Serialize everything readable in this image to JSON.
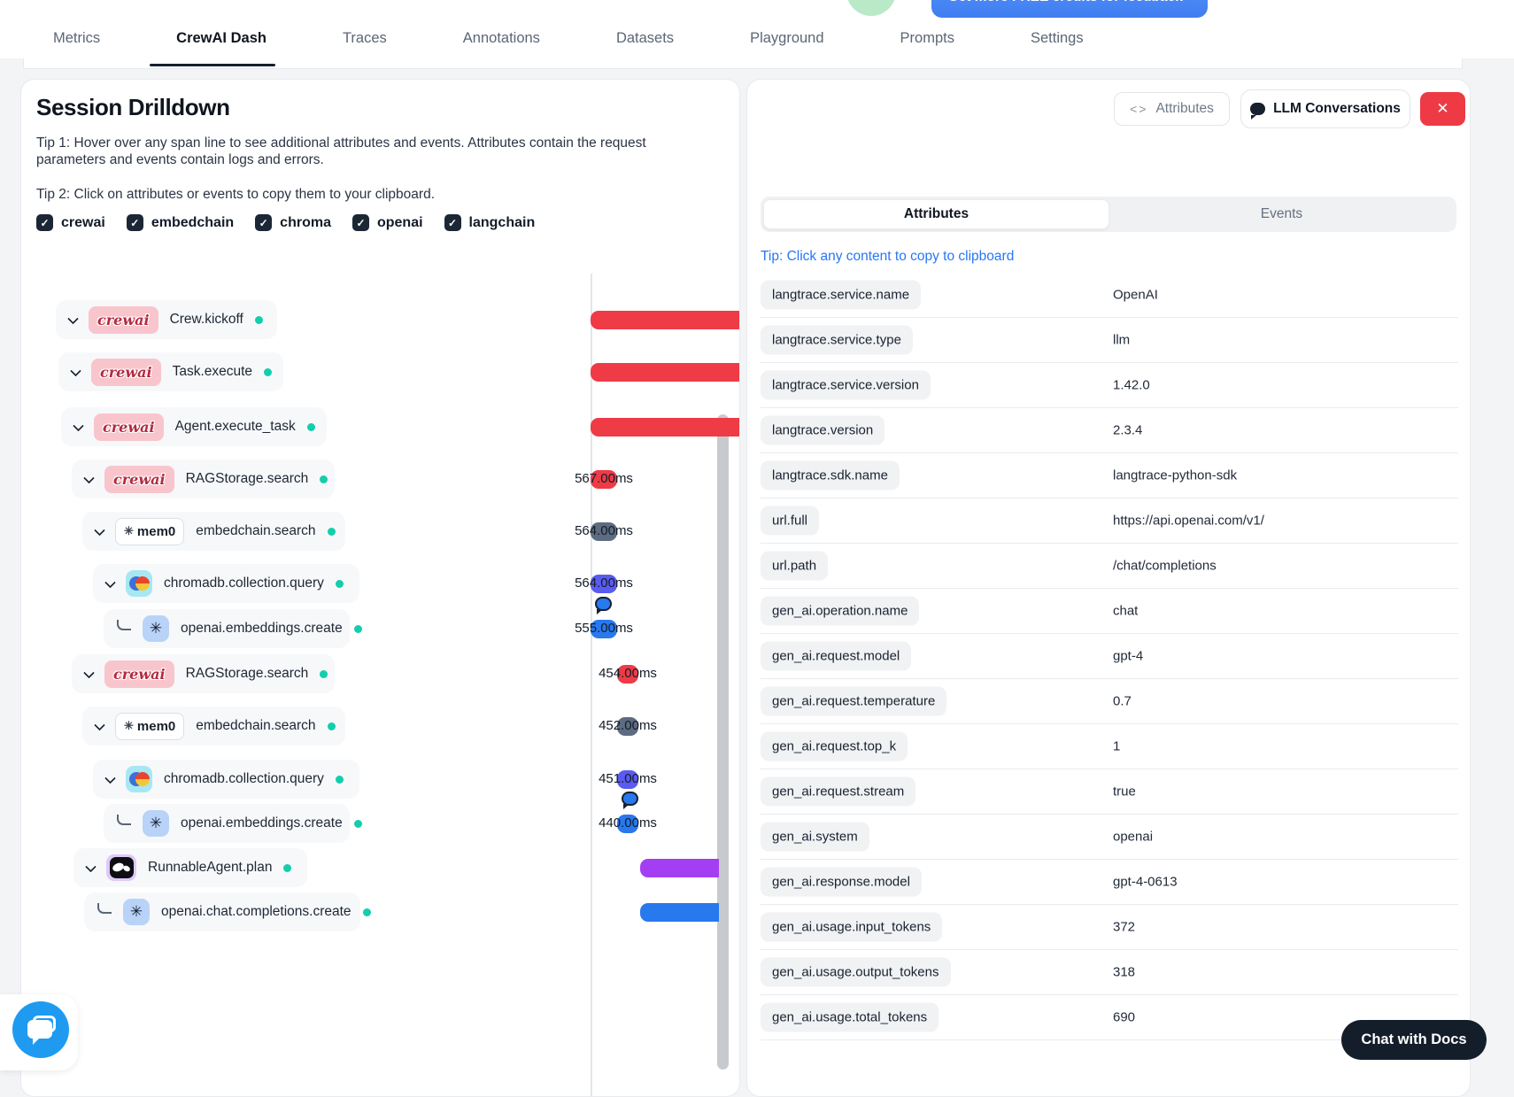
{
  "nav": {
    "tabs": [
      {
        "label": "Metrics",
        "active": false
      },
      {
        "label": "CrewAI Dash",
        "active": true
      },
      {
        "label": "Traces",
        "active": false
      },
      {
        "label": "Annotations",
        "active": false
      },
      {
        "label": "Datasets",
        "active": false
      },
      {
        "label": "Playground",
        "active": false
      },
      {
        "label": "Prompts",
        "active": false
      },
      {
        "label": "Settings",
        "active": false
      }
    ],
    "credits_button": "Get more FREE credits for feedback  ›"
  },
  "drilldown": {
    "title": "Session Drilldown",
    "tip1": "Tip 1: Hover over any span line to see additional attributes and events. Attributes contain the request parameters and events contain logs and errors.",
    "tip2": "Tip 2: Click on attributes or events to copy them to your clipboard.",
    "filters": [
      "crewai",
      "embedchain",
      "chroma",
      "openai",
      "langchain"
    ],
    "spans": [
      {
        "name": "Crew.kickoff",
        "vendor": "crewai",
        "bar": "long",
        "duration": ""
      },
      {
        "name": "Task.execute",
        "vendor": "crewai",
        "bar": "long",
        "duration": ""
      },
      {
        "name": "Agent.execute_task",
        "vendor": "crewai",
        "bar": "long",
        "duration": ""
      },
      {
        "name": "RAGStorage.search",
        "vendor": "crewai",
        "bar": "mini1",
        "duration": "567.00ms"
      },
      {
        "name": "embedchain.search",
        "vendor": "mem0",
        "bar": "mini1",
        "duration": "564.00ms"
      },
      {
        "name": "chromadb.collection.query",
        "vendor": "chroma",
        "bar": "mini1",
        "duration": "564.00ms"
      },
      {
        "name": "openai.embeddings.create",
        "vendor": "openai",
        "bar": "mini1",
        "duration": "555.00ms",
        "leaf": true,
        "bubble": true
      },
      {
        "name": "RAGStorage.search",
        "vendor": "crewai",
        "bar": "mini2",
        "duration": "454.00ms"
      },
      {
        "name": "embedchain.search",
        "vendor": "mem0",
        "bar": "mini2",
        "duration": "452.00ms"
      },
      {
        "name": "chromadb.collection.query",
        "vendor": "chroma",
        "bar": "mini2",
        "duration": "451.00ms"
      },
      {
        "name": "openai.embeddings.create",
        "vendor": "openai",
        "bar": "mini2",
        "duration": "440.00ms",
        "leaf": true,
        "bubble": true
      },
      {
        "name": "RunnableAgent.plan",
        "vendor": "langchain",
        "bar": "tail",
        "duration": ""
      },
      {
        "name": "openai.chat.completions.create",
        "vendor": "openai",
        "bar": "tail",
        "duration": "",
        "leaf": true
      }
    ]
  },
  "panel": {
    "attributes_button": "Attributes",
    "llm_button": "LLM Conversations",
    "close_label": "✕",
    "code_icon": "<>",
    "tabs": {
      "attributes": "Attributes",
      "events": "Events"
    },
    "copy_tip": "Tip: Click any content to copy to clipboard",
    "rows": [
      {
        "key": "langtrace.service.name",
        "value": "OpenAI"
      },
      {
        "key": "langtrace.service.type",
        "value": "llm"
      },
      {
        "key": "langtrace.service.version",
        "value": "1.42.0"
      },
      {
        "key": "langtrace.version",
        "value": "2.3.4"
      },
      {
        "key": "langtrace.sdk.name",
        "value": "langtrace-python-sdk"
      },
      {
        "key": "url.full",
        "value": "https://api.openai.com/v1/"
      },
      {
        "key": "url.path",
        "value": "/chat/completions"
      },
      {
        "key": "gen_ai.operation.name",
        "value": "chat"
      },
      {
        "key": "gen_ai.request.model",
        "value": "gpt-4"
      },
      {
        "key": "gen_ai.request.temperature",
        "value": "0.7"
      },
      {
        "key": "gen_ai.request.top_k",
        "value": "1"
      },
      {
        "key": "gen_ai.request.stream",
        "value": "true"
      },
      {
        "key": "gen_ai.system",
        "value": "openai"
      },
      {
        "key": "gen_ai.response.model",
        "value": "gpt-4-0613"
      },
      {
        "key": "gen_ai.usage.input_tokens",
        "value": "372"
      },
      {
        "key": "gen_ai.usage.output_tokens",
        "value": "318"
      },
      {
        "key": "gen_ai.usage.total_tokens",
        "value": "690"
      }
    ]
  },
  "chat_docs_button": "Chat with Docs",
  "colors": {
    "crewai": "#ee3b46",
    "mem0": "#5d6c80",
    "chroma": "#5a5bf0",
    "openai": "#2878ee",
    "langchain": "#a43ef3",
    "status_dot": "#12ceac",
    "link": "#2777f5",
    "close_button": "#ee3a44"
  }
}
